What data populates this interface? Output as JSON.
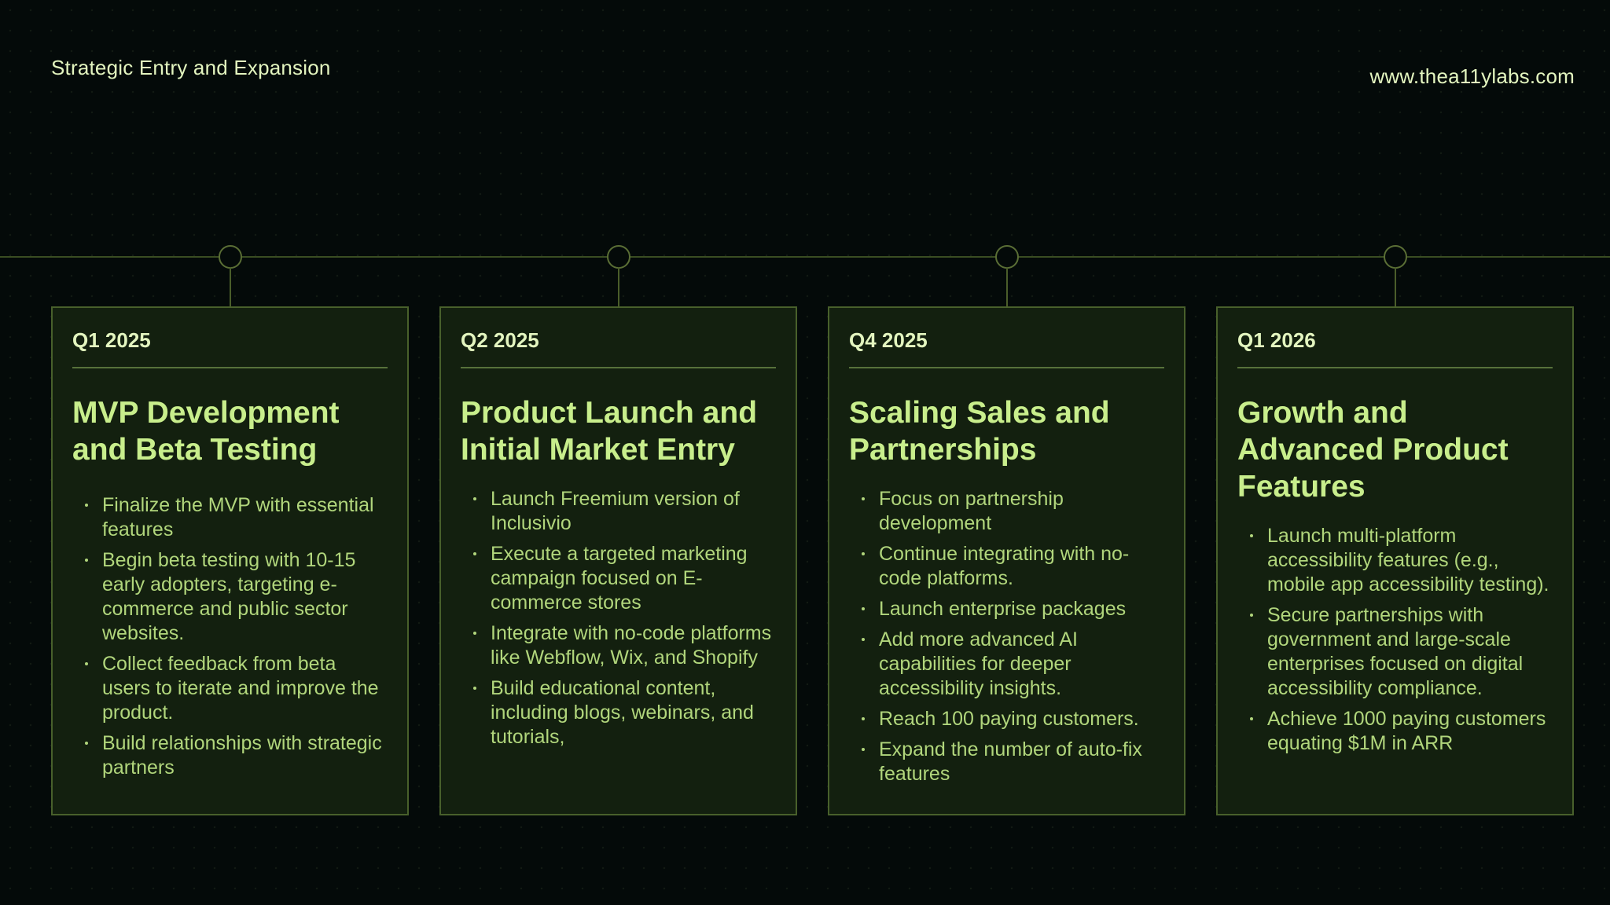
{
  "header": {
    "title": "Strategic Entry and Expansion",
    "url": "www.thea11ylabs.com"
  },
  "colors": {
    "background": "#040a09",
    "card_background": "#13200f",
    "card_border": "#48602b",
    "title_green": "#c8ee8c",
    "text_green": "#b1d67c"
  },
  "milestones": [
    {
      "quarter": "Q1 2025",
      "title": "MVP Development and Beta Testing",
      "items": [
        "Finalize the MVP with essential features",
        "Begin beta testing with 10-15 early adopters, targeting e-commerce and public sector websites.",
        "Collect feedback from beta users to iterate and improve the product.",
        "Build relationships with strategic partners"
      ]
    },
    {
      "quarter": "Q2 2025",
      "title": "Product Launch and Initial Market Entry",
      "items": [
        "Launch Freemium version of Inclusivio",
        "Execute a targeted marketing campaign focused on E-commerce stores",
        "Integrate with no-code platforms like Webflow, Wix, and Shopify",
        "Build educational content, including blogs, webinars, and tutorials,"
      ]
    },
    {
      "quarter": "Q4 2025",
      "title": "Scaling Sales and Partnerships",
      "items": [
        "Focus on partnership development",
        "Continue integrating with no-code platforms.",
        "Launch enterprise packages",
        "Add more advanced AI capabilities for deeper accessibility insights.",
        "Reach 100 paying customers.",
        "Expand the number of auto-fix features"
      ]
    },
    {
      "quarter": "Q1 2026",
      "title": "Growth and Advanced Product Features",
      "items": [
        "Launch multi-platform accessibility features (e.g., mobile app accessibility testing).",
        "Secure partnerships with government and large-scale enterprises focused on digital accessibility compliance.",
        "Achieve 1000 paying customers equating $1M in ARR"
      ]
    }
  ]
}
